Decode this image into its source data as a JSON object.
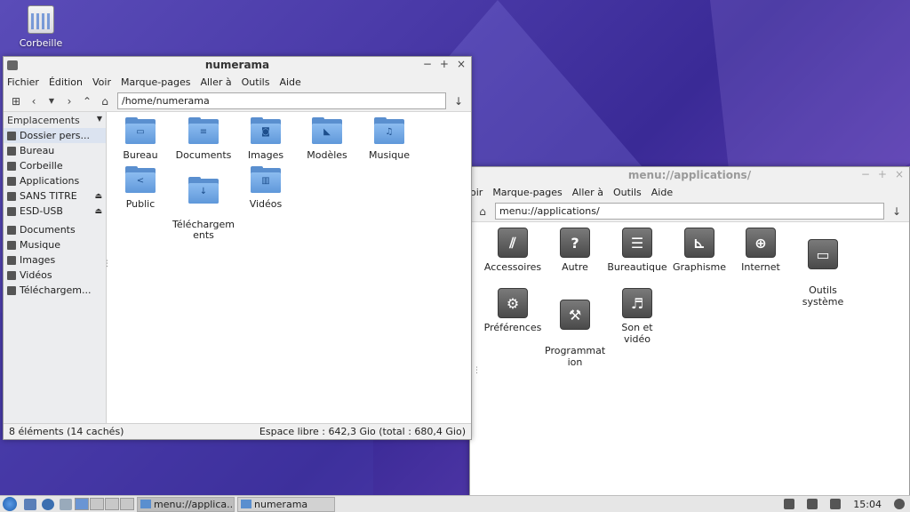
{
  "desktop": {
    "trash_label": "Corbeille"
  },
  "fm_window": {
    "title": "numerama",
    "controls": [
      "−",
      "+",
      "×"
    ],
    "menu": [
      "Fichier",
      "Édition",
      "Voir",
      "Marque-pages",
      "Aller à",
      "Outils",
      "Aide"
    ],
    "address": "/home/numerama",
    "sidebar_header": "Emplacements",
    "places": [
      {
        "label": "Dossier pers...",
        "icon": "home-icon"
      },
      {
        "label": "Bureau",
        "icon": "desktop-icon"
      },
      {
        "label": "Corbeille",
        "icon": "trash-icon"
      },
      {
        "label": "Applications",
        "icon": "applications-icon"
      },
      {
        "label": "SANS TITRE",
        "icon": "drive-icon"
      },
      {
        "label": "ESD-USB",
        "icon": "drive-icon"
      }
    ],
    "bookmarks": [
      {
        "label": "Documents",
        "icon": "documents-icon"
      },
      {
        "label": "Musique",
        "icon": "music-icon"
      },
      {
        "label": "Images",
        "icon": "images-icon"
      },
      {
        "label": "Vidéos",
        "icon": "videos-icon"
      },
      {
        "label": "Téléchargem...",
        "icon": "download-icon"
      }
    ],
    "eject_glyph": "⏏",
    "folders": [
      {
        "label": "Bureau",
        "glyph": "▭"
      },
      {
        "label": "Documents",
        "glyph": "≡"
      },
      {
        "label": "Images",
        "glyph": "◙"
      },
      {
        "label": "Modèles",
        "glyph": "◣"
      },
      {
        "label": "Musique",
        "glyph": "♫"
      },
      {
        "label": "Public",
        "glyph": "<"
      },
      {
        "label": "Téléchargem\nents",
        "glyph": "↓"
      },
      {
        "label": "Vidéos",
        "glyph": "▥"
      }
    ],
    "status_left": "8 éléments (14 cachés)",
    "status_right": "Espace libre : 642,3 Gio (total : 680,4 Gio)"
  },
  "app_window": {
    "title": "menu://applications/",
    "controls": [
      "−",
      "+",
      "×"
    ],
    "menu": [
      "oir",
      "Marque-pages",
      "Aller à",
      "Outils",
      "Aide"
    ],
    "address": "menu://applications/",
    "apps": [
      {
        "label": "Accessoires",
        "glyph": "⫽"
      },
      {
        "label": "Autre",
        "glyph": "?"
      },
      {
        "label": "Bureautique",
        "glyph": "☰"
      },
      {
        "label": "Graphisme",
        "glyph": "⊾"
      },
      {
        "label": "Internet",
        "glyph": "⊕"
      },
      {
        "label": "Outils\nsystème",
        "glyph": "▭"
      },
      {
        "label": "Préférences",
        "glyph": "⚙"
      },
      {
        "label": "Programmat\nion",
        "glyph": "⚒"
      },
      {
        "label": "Son et vidéo",
        "glyph": "♬"
      }
    ]
  },
  "taskbar": {
    "tasks": [
      {
        "label": "menu://applica...",
        "active": true
      },
      {
        "label": "numerama",
        "active": false
      }
    ],
    "clock": "15:04"
  }
}
